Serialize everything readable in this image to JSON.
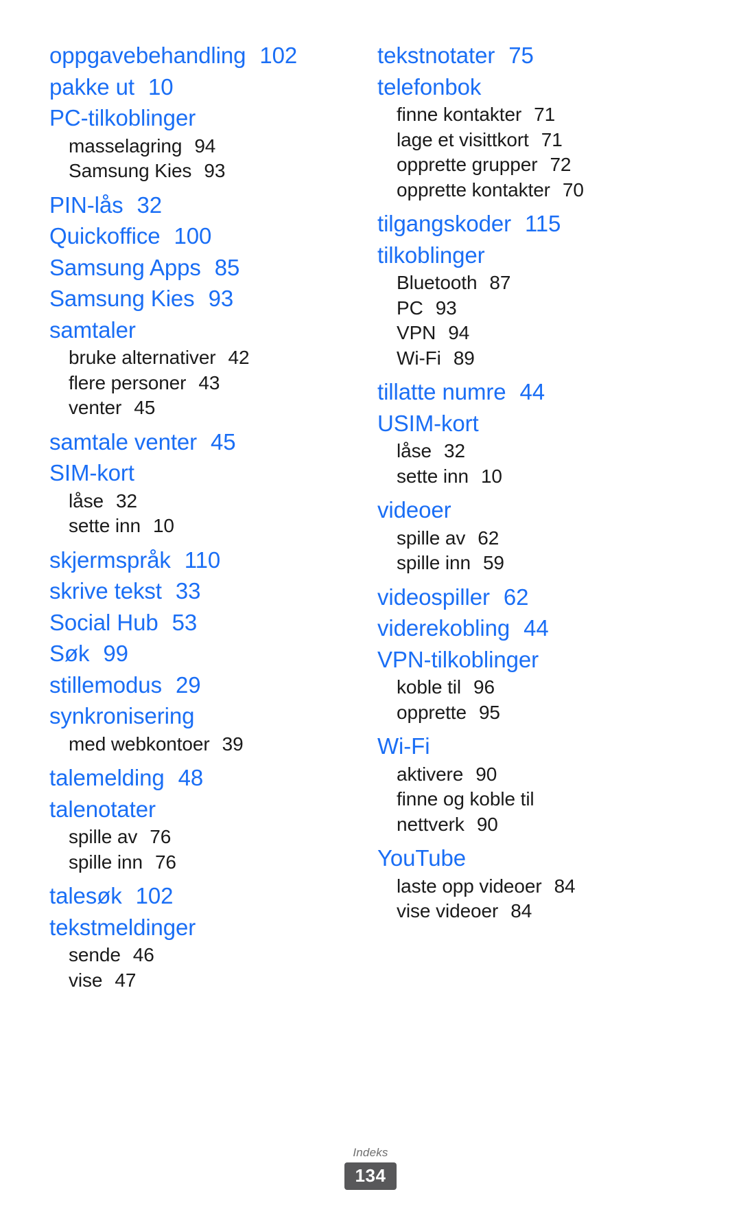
{
  "document": {
    "footer_label": "Indeks",
    "page_number": "134",
    "accent_color": "#1a6ef5",
    "sub_color": "#1a1a1a",
    "badge_color": "#58585a"
  },
  "left_column": [
    {
      "term": "oppgavebehandling",
      "page": "102",
      "subs": []
    },
    {
      "term": "pakke ut",
      "page": "10",
      "subs": []
    },
    {
      "term": "PC-tilkoblinger",
      "page": "",
      "subs": [
        {
          "term": "masselagring",
          "page": "94"
        },
        {
          "term": "Samsung Kies",
          "page": "93"
        }
      ]
    },
    {
      "term": "PIN-lås",
      "page": "32",
      "subs": []
    },
    {
      "term": "Quickoffice",
      "page": "100",
      "subs": []
    },
    {
      "term": "Samsung Apps",
      "page": "85",
      "subs": []
    },
    {
      "term": "Samsung Kies",
      "page": "93",
      "subs": []
    },
    {
      "term": "samtaler",
      "page": "",
      "subs": [
        {
          "term": "bruke alternativer",
          "page": "42"
        },
        {
          "term": "flere personer",
          "page": "43"
        },
        {
          "term": "venter",
          "page": "45"
        }
      ]
    },
    {
      "term": "samtale venter",
      "page": "45",
      "subs": []
    },
    {
      "term": "SIM-kort",
      "page": "",
      "subs": [
        {
          "term": "låse",
          "page": "32"
        },
        {
          "term": "sette inn",
          "page": "10"
        }
      ]
    },
    {
      "term": "skjermspråk",
      "page": "110",
      "subs": []
    },
    {
      "term": "skrive tekst",
      "page": "33",
      "subs": []
    },
    {
      "term": "Social Hub",
      "page": "53",
      "subs": []
    },
    {
      "term": "Søk",
      "page": "99",
      "subs": []
    },
    {
      "term": "stillemodus",
      "page": "29",
      "subs": []
    },
    {
      "term": "synkronisering",
      "page": "",
      "subs": [
        {
          "term": "med webkontoer",
          "page": "39"
        }
      ]
    },
    {
      "term": "talemelding",
      "page": "48",
      "subs": []
    },
    {
      "term": "talenotater",
      "page": "",
      "subs": [
        {
          "term": "spille av",
          "page": "76"
        },
        {
          "term": "spille inn",
          "page": "76"
        }
      ]
    },
    {
      "term": "talesøk",
      "page": "102",
      "subs": []
    },
    {
      "term": "tekstmeldinger",
      "page": "",
      "subs": [
        {
          "term": "sende",
          "page": "46"
        },
        {
          "term": "vise",
          "page": "47"
        }
      ]
    }
  ],
  "right_column": [
    {
      "term": "tekstnotater",
      "page": "75",
      "subs": []
    },
    {
      "term": "telefonbok",
      "page": "",
      "subs": [
        {
          "term": "finne kontakter",
          "page": "71"
        },
        {
          "term": "lage et visittkort",
          "page": "71"
        },
        {
          "term": "opprette grupper",
          "page": "72"
        },
        {
          "term": "opprette kontakter",
          "page": "70"
        }
      ]
    },
    {
      "term": "tilgangskoder",
      "page": "115",
      "subs": []
    },
    {
      "term": "tilkoblinger",
      "page": "",
      "subs": [
        {
          "term": "Bluetooth",
          "page": "87"
        },
        {
          "term": "PC",
          "page": "93"
        },
        {
          "term": "VPN",
          "page": "94"
        },
        {
          "term": "Wi-Fi",
          "page": "89"
        }
      ]
    },
    {
      "term": "tillatte numre",
      "page": "44",
      "subs": []
    },
    {
      "term": "USIM-kort",
      "page": "",
      "subs": [
        {
          "term": "låse",
          "page": "32"
        },
        {
          "term": "sette inn",
          "page": "10"
        }
      ]
    },
    {
      "term": "videoer",
      "page": "",
      "subs": [
        {
          "term": "spille av",
          "page": "62"
        },
        {
          "term": "spille inn",
          "page": "59"
        }
      ]
    },
    {
      "term": "videospiller",
      "page": "62",
      "subs": []
    },
    {
      "term": "viderekobling",
      "page": "44",
      "subs": []
    },
    {
      "term": "VPN-tilkoblinger",
      "page": "",
      "subs": [
        {
          "term": "koble til",
          "page": "96"
        },
        {
          "term": "opprette",
          "page": "95"
        }
      ]
    },
    {
      "term": "Wi-Fi",
      "page": "",
      "subs": [
        {
          "term": "aktivere",
          "page": "90"
        },
        {
          "term": "finne og koble til",
          "page": ""
        },
        {
          "term": "nettverk",
          "page": "90"
        }
      ]
    },
    {
      "term": "YouTube",
      "page": "",
      "subs": [
        {
          "term": "laste opp videoer",
          "page": "84"
        },
        {
          "term": "vise videoer",
          "page": "84"
        }
      ]
    }
  ]
}
